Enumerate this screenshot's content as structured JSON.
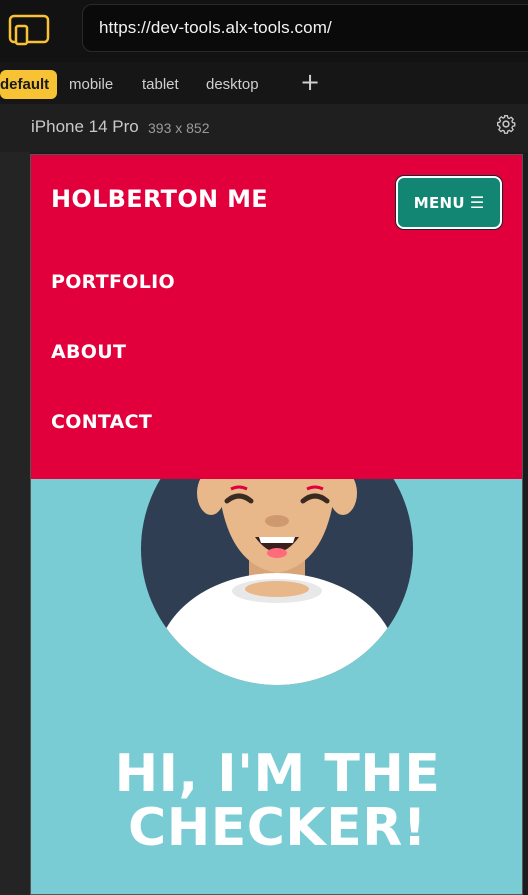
{
  "browser": {
    "url": "https://dev-tools.alx-tools.com/",
    "device_icon": "responsive-device-icon"
  },
  "tabs": [
    {
      "label": "default"
    },
    {
      "label": "mobile"
    },
    {
      "label": "tablet"
    },
    {
      "label": "desktop"
    }
  ],
  "add_tab_label": "+",
  "device": {
    "name": "iPhone 14 Pro",
    "size": "393 x 852",
    "settings_icon": "gear-icon"
  },
  "site": {
    "brand": "HOLBERTON ME",
    "menu_label": "MENU",
    "menu_icon": "☰",
    "nav_links": [
      "PORTFOLIO",
      "ABOUT",
      "CONTACT"
    ],
    "hero_line1": "HI, I'M THE",
    "hero_line2": "CHECKER!"
  },
  "colors": {
    "nav_bg": "#e1003c",
    "menu_btn": "#138673",
    "hero_bg": "#79ccd3",
    "tab_active": "#f7c234"
  }
}
